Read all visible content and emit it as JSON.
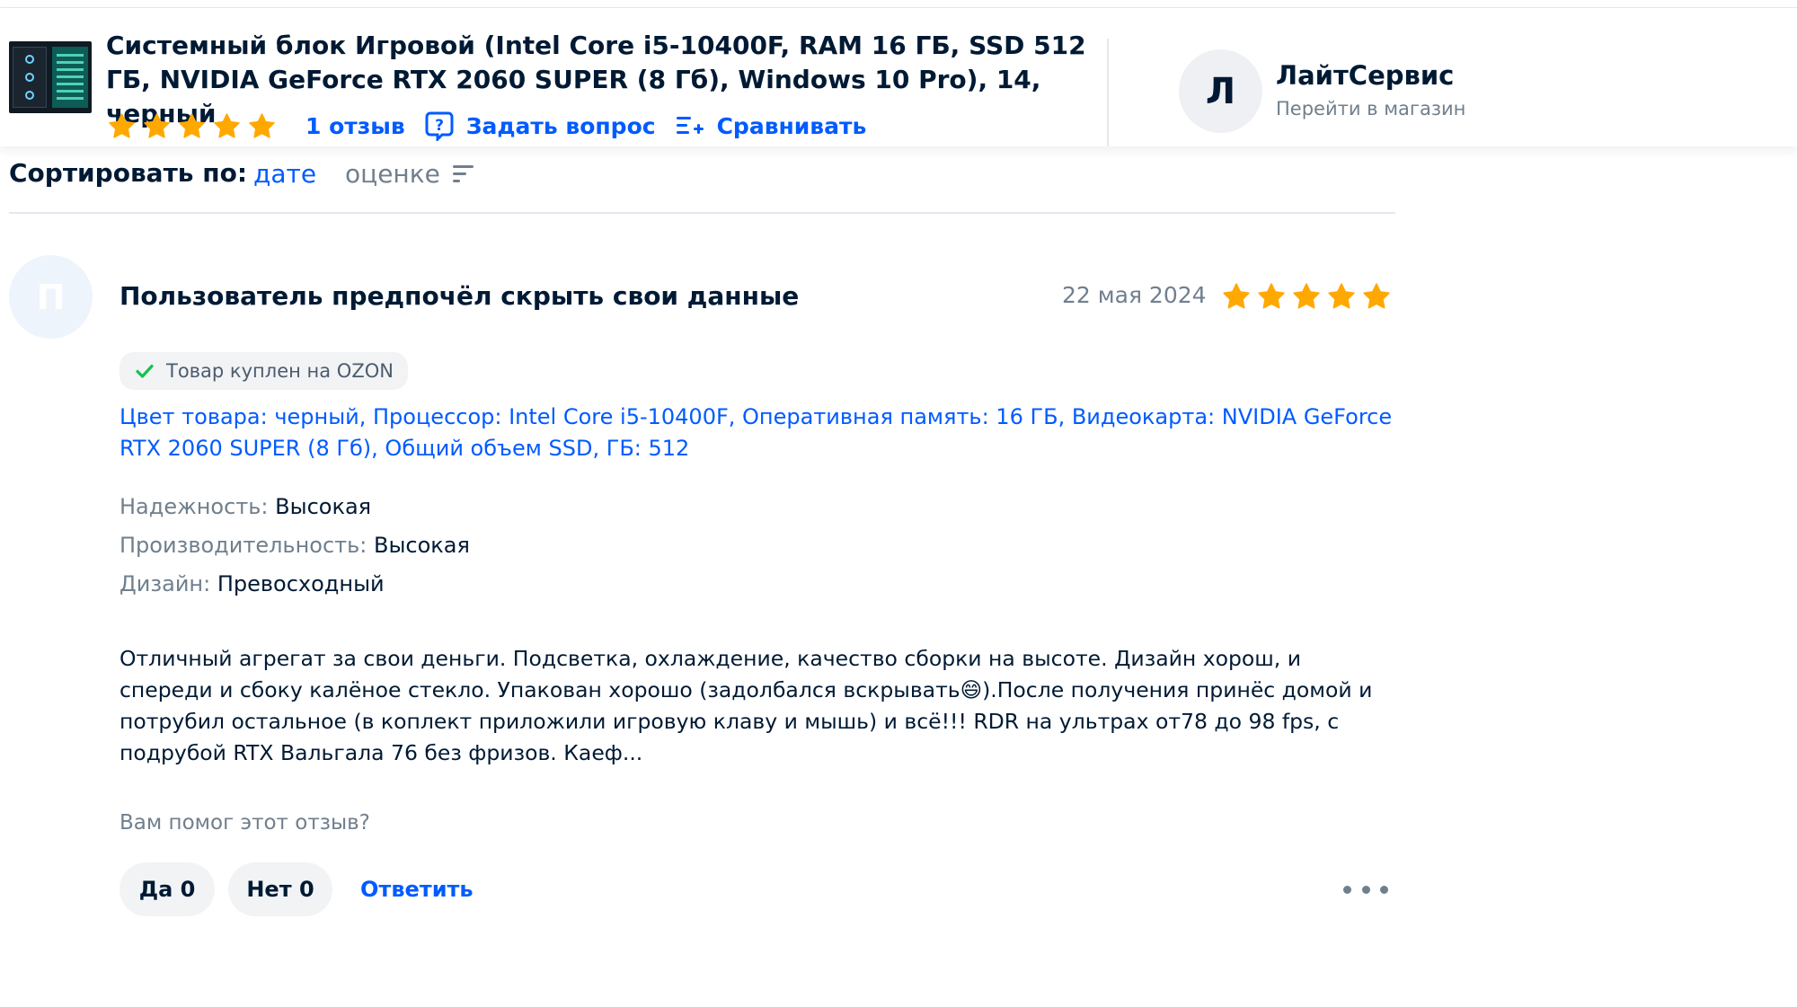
{
  "product": {
    "title": "Системный блок Игровой (Intel Core i5-10400F, RAM 16 ГБ, SSD 512 ГБ, NVIDIA GeForce RTX 2060 SUPER (8 Гб), Windows 10 Pro), 14, черный",
    "rating_stars": 5,
    "reviews_link": "1 отзыв",
    "ask_link": "Задать вопрос",
    "compare_link": "Сравнивать"
  },
  "seller": {
    "avatar_letter": "Л",
    "name": "ЛайтСервис",
    "link": "Перейти в магазин"
  },
  "sort": {
    "label": "Сортировать по:",
    "by_date": "дате",
    "by_rating": "оценке"
  },
  "review": {
    "avatar_letter": "П",
    "author": "Пользователь предпочёл скрыть свои данные",
    "date": "22 мая 2024",
    "stars": 5,
    "badge": "Товар куплен на OZON",
    "variant": "Цвет товара: черный, Процессор: Intel Core i5-10400F, Оперативная память: 16 ГБ, Видеокарта: NVIDIA GeForce RTX 2060 SUPER (8 Гб), Общий объем SSD, ГБ: 512",
    "attributes": [
      {
        "key": "Надежность:",
        "value": "Высокая"
      },
      {
        "key": "Производительность:",
        "value": "Высокая"
      },
      {
        "key": "Дизайн:",
        "value": "Превосходный"
      }
    ],
    "text": "Отличный агрегат за свои деньги. Подсветка, охлаждение, качество сборки на высоте. Дизайн хорош, и спереди и сбоку калёное стекло. Упакован хорошо (задолбался вскрывать😄).После получения принёс домой и потрубил остальное (в коплект приложили игровую клаву и мышь) и всё!!! RDR на ультрах от78 до 98 fps, с подрубой RTX Вальгала 76 без фризов. Каеф...",
    "helpful_question": "Вам помог этот отзыв?",
    "yes_label": "Да 0",
    "no_label": "Нет 0",
    "reply_label": "Ответить"
  },
  "colors": {
    "accent": "#005bff",
    "star": "#ffa800",
    "text": "#001a34",
    "muted": "#707f8d",
    "check": "#10c44c"
  }
}
